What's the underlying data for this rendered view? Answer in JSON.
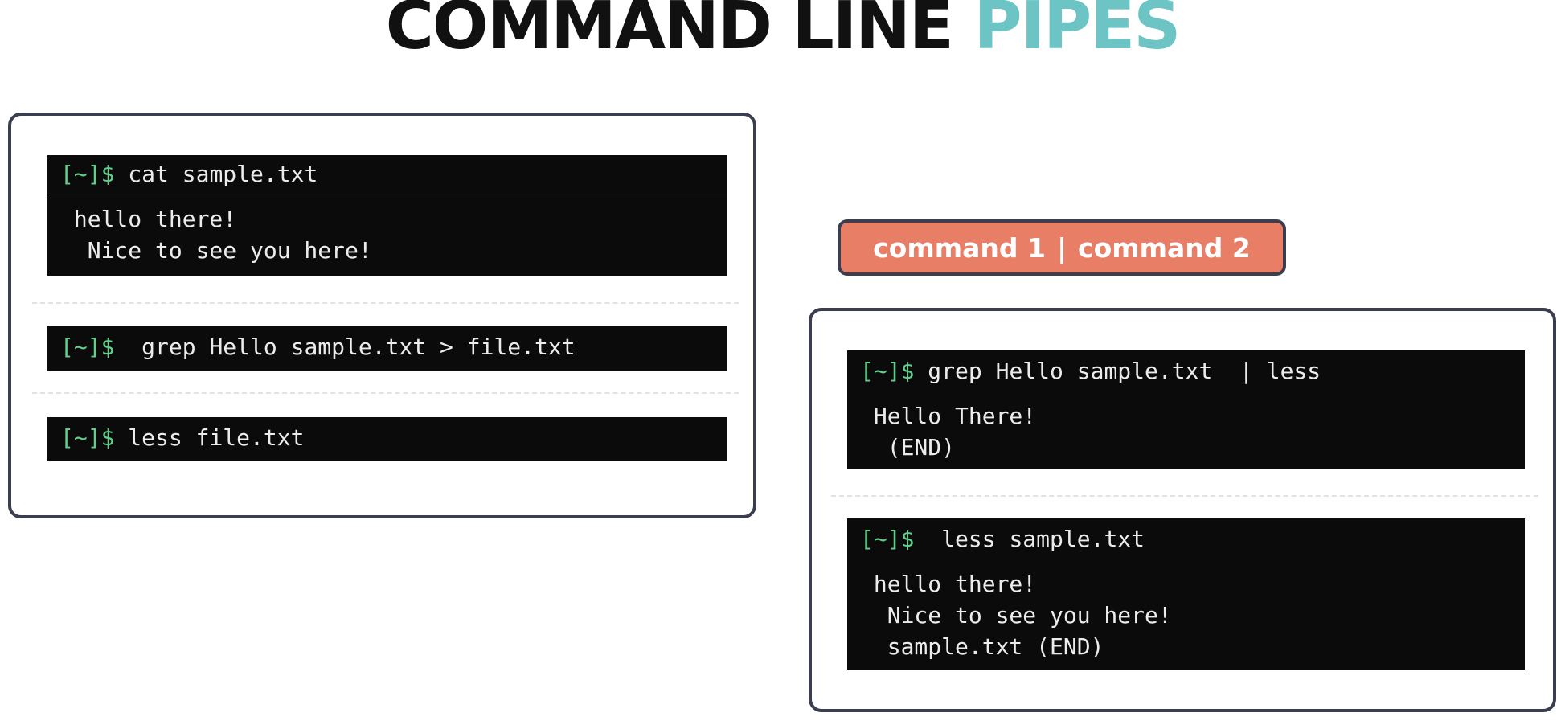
{
  "title": {
    "part1": "COMMAND LINE",
    "part2": "PIPES"
  },
  "colors": {
    "accent_teal": "#6cc4c4",
    "pill_orange": "#e97e67",
    "prompt_green": "#5fd18c",
    "terminal_bg": "#0b0b0b",
    "panel_border": "#3a3e4e"
  },
  "pipe_label": {
    "left": "command 1",
    "separator": "|",
    "right": "command 2"
  },
  "left_panel": {
    "block1": {
      "prompt": "[~]$",
      "command": " cat sample.txt",
      "output": [
        " hello there!",
        "  Nice to see you here!"
      ]
    },
    "block2": {
      "prompt": "[~]$",
      "command": "  grep Hello sample.txt > file.txt"
    },
    "block3": {
      "prompt": "[~]$",
      "command": " less file.txt"
    }
  },
  "right_panel": {
    "block1": {
      "prompt": "[~]$",
      "command": " grep Hello sample.txt  | less",
      "output": [
        " Hello There!",
        "  (END)"
      ]
    },
    "block2": {
      "prompt": "[~]$",
      "command": "  less sample.txt",
      "output": [
        " hello there!",
        "  Nice to see you here!",
        "  sample.txt (END)"
      ]
    }
  }
}
